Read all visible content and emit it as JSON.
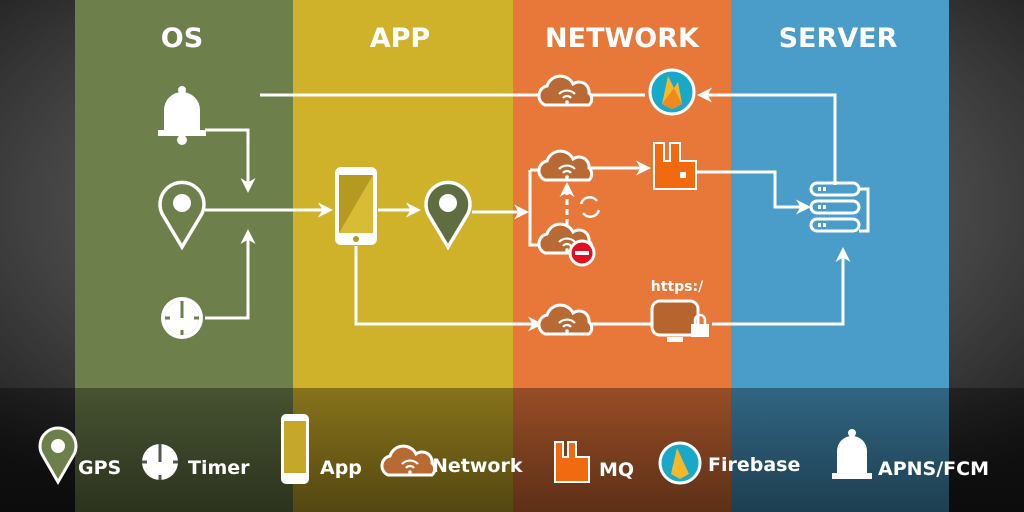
{
  "columns": [
    {
      "label": "OS",
      "color": "#6d7f4b"
    },
    {
      "label": "APP",
      "color": "#d0b12a"
    },
    {
      "label": "NETWORK",
      "color": "#e8773a"
    },
    {
      "label": "SERVER",
      "color": "#4a9cc9"
    }
  ],
  "diagram": {
    "https_label": "https:/"
  },
  "legend": [
    {
      "icon": "map-pin-icon",
      "label": "GPS"
    },
    {
      "icon": "timer-icon",
      "label": "Timer"
    },
    {
      "icon": "smartphone-icon",
      "label": "App"
    },
    {
      "icon": "cloud-wifi-icon",
      "label": "Network"
    },
    {
      "icon": "rabbitmq-icon",
      "label": "MQ"
    },
    {
      "icon": "firebase-icon",
      "label": "Firebase"
    },
    {
      "icon": "bell-icon",
      "label": "APNS/FCM"
    }
  ],
  "colors": {
    "mq": "#f26a10",
    "firebase_ring": "#1aa8c8",
    "firebase_flame": "#f5b82a",
    "blocked": "#e01020",
    "cloud": "#b86a35"
  }
}
